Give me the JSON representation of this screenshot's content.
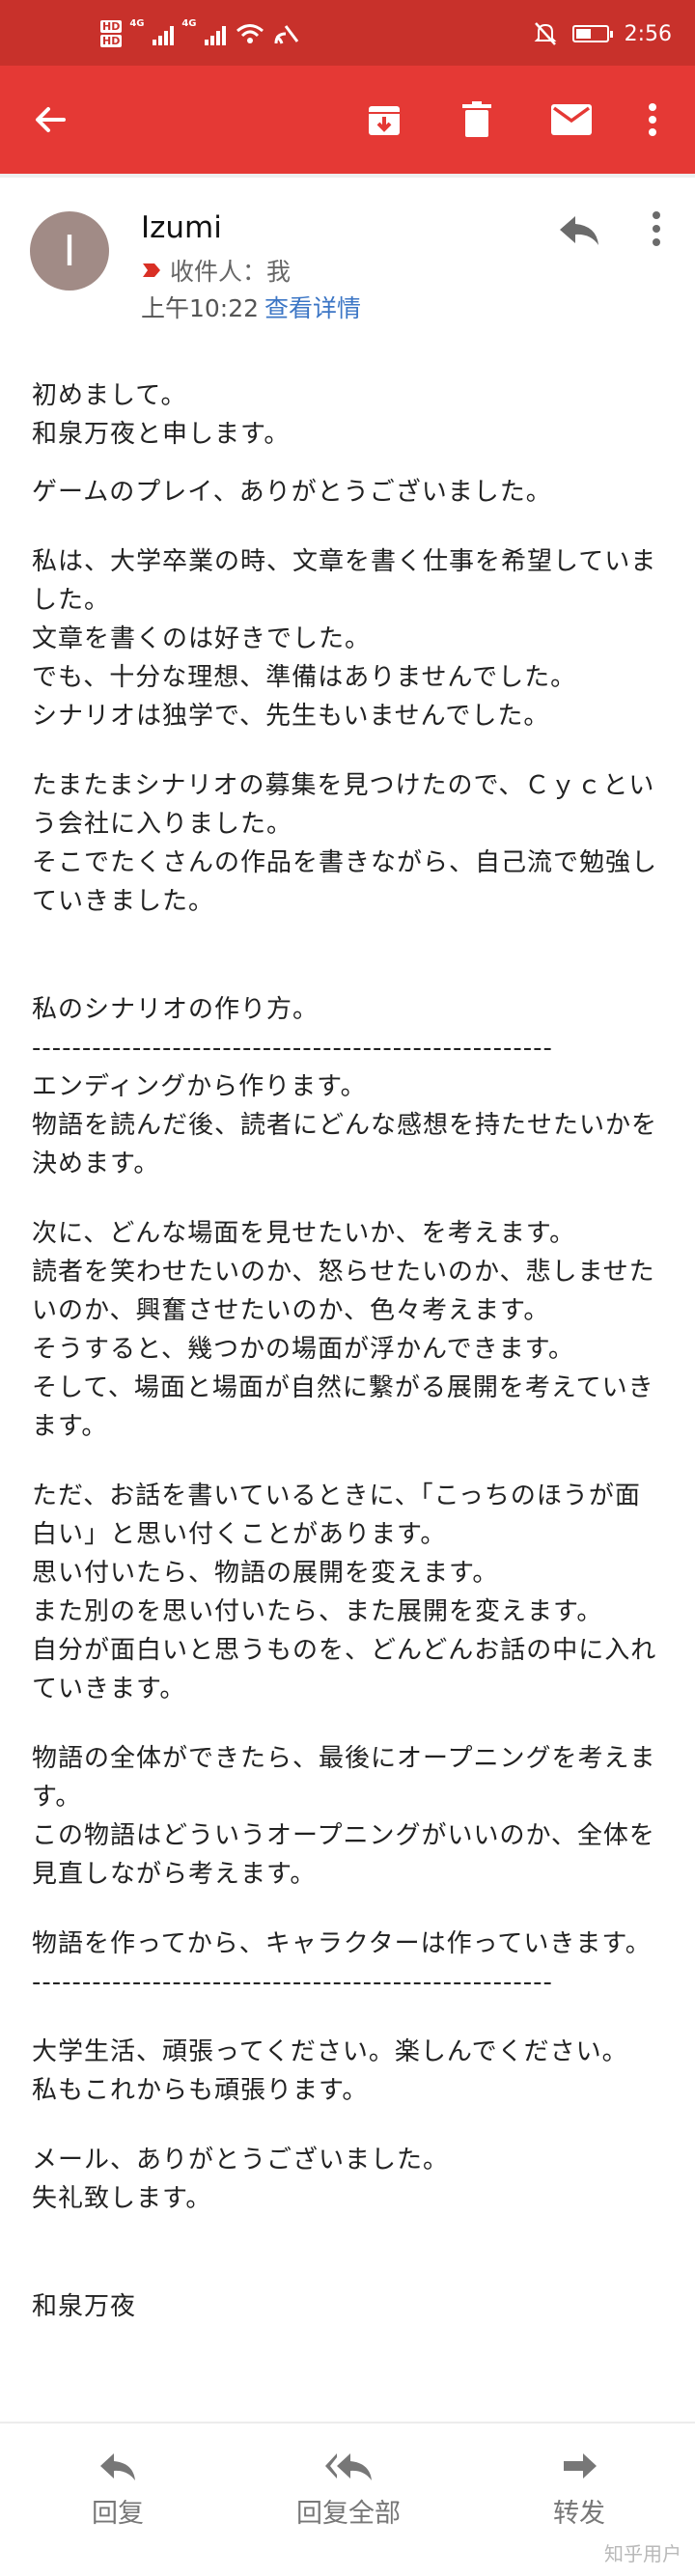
{
  "status_bar": {
    "hd1": "HD",
    "hd2": "HD",
    "net1": "4G",
    "net2": "4G",
    "time": "2:56",
    "battery_level": 0.5
  },
  "email": {
    "avatar_letter": "I",
    "sender": "Izumi",
    "recipient": "收件人：我",
    "time": "上午10:22",
    "details_link": "查看详情",
    "paragraphs": [
      "初めまして。\n和泉万夜と申します。",
      "ゲームのプレイ、ありがとうございました。",
      "私は、大学卒業の時、文章を書く仕事を希望していました。\n文章を書くのは好きでした。\nでも、十分な理想、準備はありませんでした。\nシナリオは独学で、先生もいませんでした。",
      "たまたまシナリオの募集を見つけたので、Ｃｙｃという会社に入りました。\nそこでたくさんの作品を書きながら、自己流で勉強していきました。",
      "\n私のシナリオの作り方。\n----------------------------------------------------\nエンディングから作ります。\n物語を読んだ後、読者にどんな感想を持たせたいかを決めます。",
      "次に、どんな場面を見せたいか、を考えます。\n読者を笑わせたいのか、怒らせたいのか、悲しませたいのか、興奮させたいのか、色々考えます。\nそうすると、幾つかの場面が浮かんできます。\nそして、場面と場面が自然に繋がる展開を考えていきます。",
      "ただ、お話を書いているときに、「こっちのほうが面白い」と思い付くことがあります。\n思い付いたら、物語の展開を変えます。\nまた別のを思い付いたら、また展開を変えます。\n自分が面白いと思うものを、どんどんお話の中に入れていきます。",
      "物語の全体ができたら、最後にオープニングを考えます。\nこの物語はどういうオープニングがいいのか、全体を見直しながら考えます。",
      "物語を作ってから、キャラクターは作っていきます。\n----------------------------------------------------",
      "大学生活、頑張ってください。楽しんでください。\n私もこれからも頑張ります。",
      "メール、ありがとうございました。\n失礼致します。",
      "\n和泉万夜"
    ]
  },
  "bottom_actions": {
    "reply": "回复",
    "reply_all": "回复全部",
    "forward": "转发"
  },
  "watermark": "知乎用户"
}
